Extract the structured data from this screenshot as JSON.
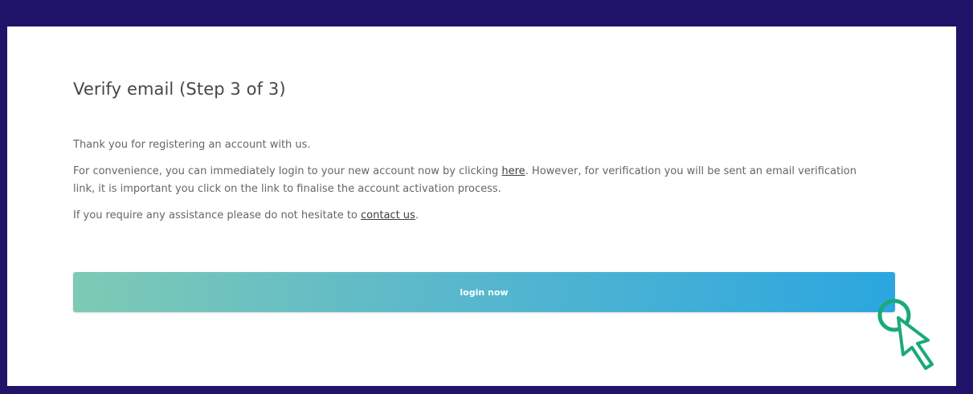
{
  "page": {
    "title": "Verify email (Step 3 of 3)",
    "thank_you": "Thank you for registering an account with us.",
    "convenience_before": "For convenience, you can immediately login to your new account now by clicking ",
    "convenience_link": "here",
    "convenience_after": ". However, for verification you will be sent an email verification link, it is important you click on the link to finalise the account activation process.",
    "assistance_before": "If you require any assistance please do not hesitate to ",
    "assistance_link": "contact us",
    "assistance_after": ".",
    "login_button": "login now"
  },
  "colors": {
    "frame": "#1f136a",
    "button_gradient_start": "#7ecab4",
    "button_gradient_end": "#2ba6e0",
    "cursor_accent": "#1aa97a"
  },
  "icons": {
    "cursor": "click-cursor-icon"
  }
}
